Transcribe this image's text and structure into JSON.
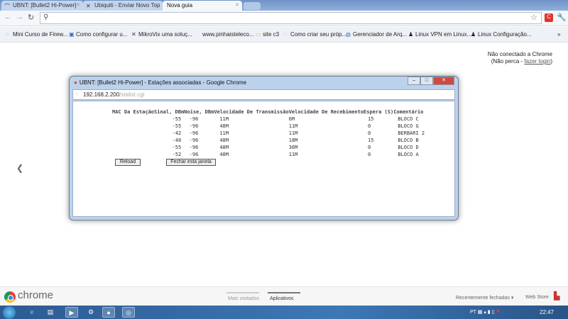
{
  "tabs": [
    {
      "label": "UBNT: [Bullet2 Hi-Power]",
      "icon": "ubnt-icon"
    },
    {
      "label": "Ubiquiti - Enviar Novo Top",
      "icon": "mikrovix-icon"
    },
    {
      "label": "Nova guia",
      "icon": "none",
      "active": true
    }
  ],
  "omnibox": {
    "value": ""
  },
  "bookmarks": [
    {
      "label": "Mini Curso de Firew..."
    },
    {
      "label": "Como configurar u..."
    },
    {
      "label": "MikroVix uma soluç..."
    },
    {
      "label": "www.pinhaisteleco..."
    },
    {
      "label": "site c3"
    },
    {
      "label": "Como criar seu próp..."
    },
    {
      "label": "Gerenciador de Arq..."
    },
    {
      "label": "Linux VPN em Linux..."
    },
    {
      "label": "Linux Configuração..."
    }
  ],
  "signin": {
    "line1": "Não conectado a Chrome",
    "prefix": "(Não perca - ",
    "link": "fazer login",
    "suffix": ")"
  },
  "popup": {
    "title": "UBNT: [Bullet2 Hi-Power] - Estações associadas - Google Chrome",
    "url_host": "192.168.2.200",
    "url_path": "/stalist.cgi",
    "columns": [
      "MAC Da Estação",
      "Sinal, DBm",
      "Noise, DBm",
      "Velocidade De Transmissão",
      "Velocidade De Recebimento",
      "Espera (S)",
      "Comentário"
    ],
    "rows": [
      [
        "",
        "-55",
        "-96",
        "11M",
        "6M",
        "15",
        "BLOCO C"
      ],
      [
        "",
        "-55",
        "-96",
        "48M",
        "11M",
        "0",
        "BLOCO G"
      ],
      [
        "",
        "-42",
        "-96",
        "11M",
        "11M",
        "0",
        "BERBARI 2"
      ],
      [
        "",
        "-48",
        "-96",
        "48M",
        "18M",
        "15",
        "BLOCO B"
      ],
      [
        "",
        "-55",
        "-96",
        "48M",
        "36M",
        "0",
        "BLOCO D"
      ],
      [
        "",
        "-52",
        "-96",
        "48M",
        "11M",
        "0",
        "BLOCO A"
      ]
    ],
    "reload_label": "Reload",
    "close_label": "Fechar esta janela"
  },
  "ntp": {
    "brand": "chrome",
    "sections": [
      "Mais visitados",
      "Aplicativos"
    ],
    "recent": "Recentemente fechadas ▾",
    "webstore": "Web Store"
  },
  "taskbar": {
    "lang": "PT",
    "clock": "22:47"
  }
}
